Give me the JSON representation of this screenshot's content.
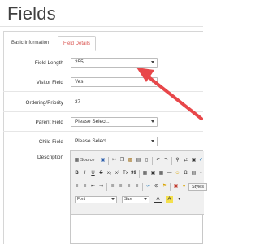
{
  "page": {
    "title": "Fields"
  },
  "tabs": [
    {
      "label": "Basic Information",
      "active": false
    },
    {
      "label": "Field Details",
      "active": true
    }
  ],
  "form": {
    "field_length": {
      "label": "Field Length",
      "value": "255"
    },
    "visitor_field": {
      "label": "Visitor Field",
      "value": "Yes"
    },
    "ordering_priority": {
      "label": "Ordering/Priority",
      "value": "37"
    },
    "parent_field": {
      "label": "Parent Field",
      "value": "Please Select..."
    },
    "child_field": {
      "label": "Child Field",
      "value": "Please Select..."
    },
    "description": {
      "label": "Description"
    }
  },
  "editor": {
    "source_label": "Source",
    "styles_label": "Styles",
    "font_label": "Font",
    "size_label": "Size",
    "bold_label": "B",
    "italic_label": "I",
    "underline_label": "U",
    "strike_label": "S",
    "subscript_label": "x₂",
    "superscript_label": "x²",
    "clear_format_label": "Tx",
    "quote_label": "99",
    "text_color_label": "A",
    "bg_color_label": "A"
  },
  "colors": {
    "active_tab_text": "#d9534f",
    "annotation_arrow": "#e8474a"
  }
}
